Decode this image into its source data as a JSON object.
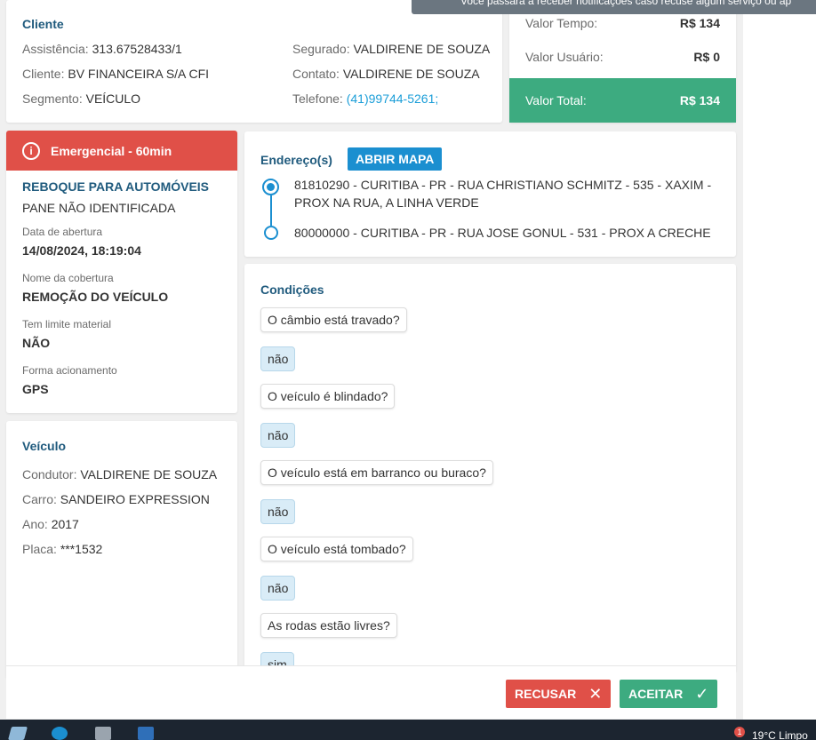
{
  "toast": {
    "text": "Você passará a receber notificações caso recuse algum serviço ou ap"
  },
  "cliente": {
    "title": "Cliente",
    "assistencia_label": "Assistência:",
    "assistencia": "313.67528433/1",
    "cliente_label": "Cliente:",
    "cliente": "BV FINANCEIRA S/A CFI",
    "segmento_label": "Segmento:",
    "segmento": "VEÍCULO",
    "segurado_label": "Segurado:",
    "segurado": "VALDIRENE DE SOUZA",
    "contato_label": "Contato:",
    "contato": "VALDIRENE DE SOUZA",
    "telefone_label": "Telefone:",
    "telefone": "(41)99744-5261;"
  },
  "valor": {
    "tempo_label": "Valor Tempo:",
    "tempo": "R$ 134",
    "usuario_label": "Valor Usuário:",
    "usuario": "R$ 0",
    "total_label": "Valor Total:",
    "total": "R$ 134"
  },
  "servico": {
    "emergencia": "Emergencial - 60min",
    "tipo": "REBOQUE PARA AUTOMÓVEIS",
    "problema": "PANE NÃO IDENTIFICADA",
    "data_label": "Data de abertura",
    "data": "14/08/2024, 18:19:04",
    "cobertura_label": "Nome da cobertura",
    "cobertura": "REMOÇÃO DO VEÍCULO",
    "limite_label": "Tem limite material",
    "limite": "NÃO",
    "forma_label": "Forma acionamento",
    "forma": "GPS"
  },
  "veiculo": {
    "title": "Veículo",
    "condutor_label": "Condutor:",
    "condutor": "VALDIRENE DE SOUZA",
    "carro_label": "Carro:",
    "carro": "SANDEIRO EXPRESSION",
    "ano_label": "Ano:",
    "ano": "2017",
    "placa_label": "Placa:",
    "placa": "***1532"
  },
  "endereco": {
    "title": "Endereço(s)",
    "map_button": "ABRIR MAPA",
    "origem": "81810290 - CURITIBA - PR - RUA CHRISTIANO SCHMITZ - 535 - XAXIM - PROX NA RUA, A LINHA VERDE",
    "destino": "80000000 - CURITIBA - PR - RUA JOSE GONUL - 531 - PROX A CRECHE"
  },
  "condicoes": {
    "title": "Condições",
    "items": [
      {
        "q": "O câmbio está travado?",
        "a": "não"
      },
      {
        "q": "O veículo é blindado?",
        "a": "não"
      },
      {
        "q": "O veículo está em barranco ou buraco?",
        "a": "não"
      },
      {
        "q": "O veículo está tombado?",
        "a": "não"
      },
      {
        "q": "As rodas estão livres?",
        "a": "sim"
      }
    ]
  },
  "actions": {
    "recusar": "RECUSAR",
    "aceitar": "ACEITAR"
  },
  "taskbar": {
    "weather": "19°C  Limpo",
    "badge": "1"
  },
  "colors": {
    "accent_blue": "#1b8fd0",
    "danger": "#e05048",
    "success": "#3dab80",
    "title": "#1f5a7d"
  }
}
